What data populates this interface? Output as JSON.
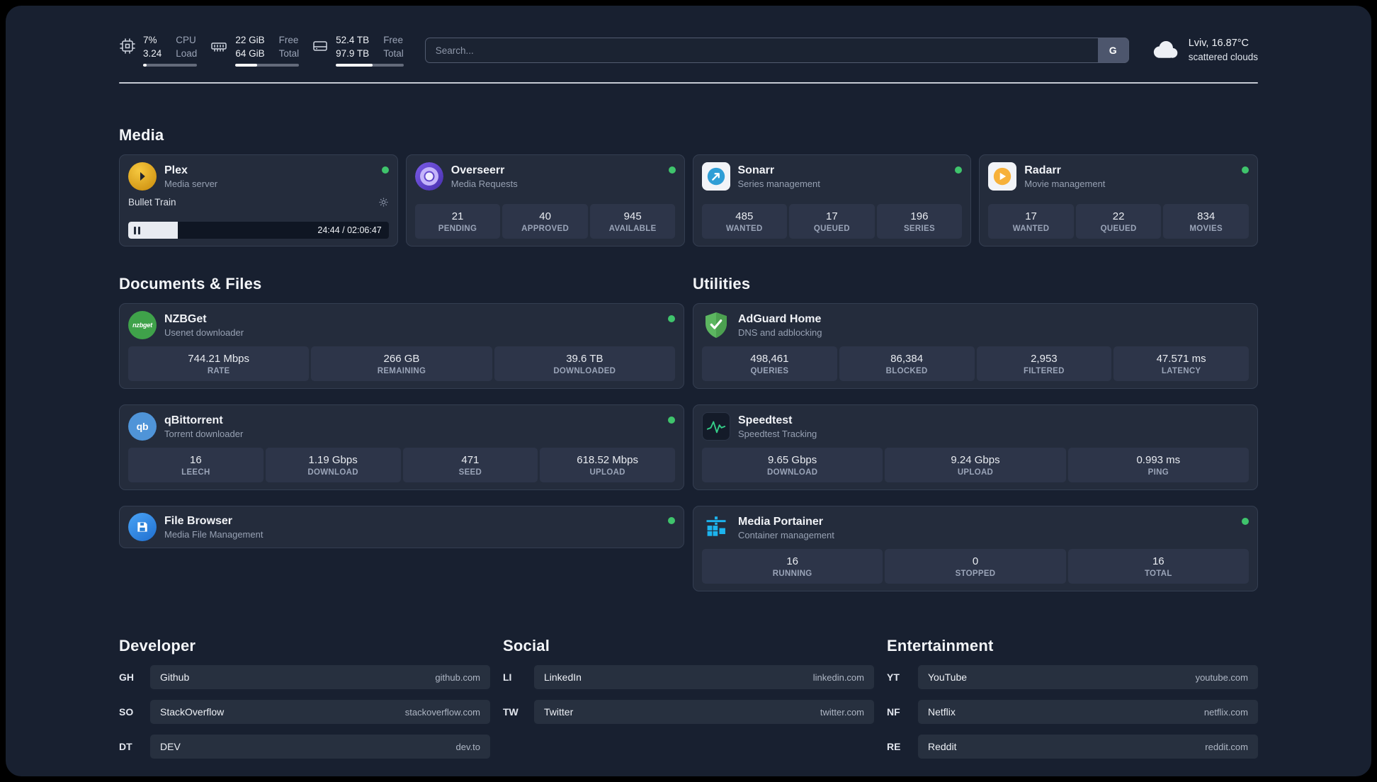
{
  "topbar": {
    "cpu": {
      "value1": "7%",
      "value2": "3.24",
      "label1": "CPU",
      "label2": "Load",
      "bar_percent": 7
    },
    "ram": {
      "value1": "22 GiB",
      "value2": "64 GiB",
      "label1": "Free",
      "label2": "Total",
      "bar_percent": 34
    },
    "disk": {
      "value1": "52.4 TB",
      "value2": "97.9 TB",
      "label1": "Free",
      "label2": "Total",
      "bar_percent": 54
    },
    "search": {
      "placeholder": "Search...",
      "button_label": "G"
    },
    "weather": {
      "location": "Lviv, 16.87°C",
      "condition": "scattered clouds"
    }
  },
  "sections": {
    "media": "Media",
    "documents": "Documents & Files",
    "utilities": "Utilities",
    "developer": "Developer",
    "social": "Social",
    "entertainment": "Entertainment"
  },
  "apps": {
    "plex": {
      "name": "Plex",
      "subtitle": "Media server",
      "now_playing": "Bullet Train",
      "time": "24:44 / 02:06:47",
      "progress_percent": 19
    },
    "overseerr": {
      "name": "Overseerr",
      "subtitle": "Media Requests",
      "stats": [
        {
          "value": "21",
          "label": "PENDING"
        },
        {
          "value": "40",
          "label": "APPROVED"
        },
        {
          "value": "945",
          "label": "AVAILABLE"
        }
      ]
    },
    "sonarr": {
      "name": "Sonarr",
      "subtitle": "Series management",
      "stats": [
        {
          "value": "485",
          "label": "WANTED"
        },
        {
          "value": "17",
          "label": "QUEUED"
        },
        {
          "value": "196",
          "label": "SERIES"
        }
      ]
    },
    "radarr": {
      "name": "Radarr",
      "subtitle": "Movie management",
      "stats": [
        {
          "value": "17",
          "label": "WANTED"
        },
        {
          "value": "22",
          "label": "QUEUED"
        },
        {
          "value": "834",
          "label": "MOVIES"
        }
      ]
    },
    "nzbget": {
      "name": "NZBGet",
      "subtitle": "Usenet downloader",
      "icon_text": "nzbget",
      "stats": [
        {
          "value": "744.21 Mbps",
          "label": "RATE"
        },
        {
          "value": "266 GB",
          "label": "REMAINING"
        },
        {
          "value": "39.6 TB",
          "label": "DOWNLOADED"
        }
      ]
    },
    "qbittorrent": {
      "name": "qBittorrent",
      "subtitle": "Torrent downloader",
      "icon_text": "qb",
      "stats": [
        {
          "value": "16",
          "label": "LEECH"
        },
        {
          "value": "1.19 Gbps",
          "label": "DOWNLOAD"
        },
        {
          "value": "471",
          "label": "SEED"
        },
        {
          "value": "618.52 Mbps",
          "label": "UPLOAD"
        }
      ]
    },
    "filebrowser": {
      "name": "File Browser",
      "subtitle": "Media File Management"
    },
    "adguard": {
      "name": "AdGuard Home",
      "subtitle": "DNS and adblocking",
      "stats": [
        {
          "value": "498,461",
          "label": "QUERIES"
        },
        {
          "value": "86,384",
          "label": "BLOCKED"
        },
        {
          "value": "2,953",
          "label": "FILTERED"
        },
        {
          "value": "47.571 ms",
          "label": "LATENCY"
        }
      ]
    },
    "speedtest": {
      "name": "Speedtest",
      "subtitle": "Speedtest Tracking",
      "stats": [
        {
          "value": "9.65 Gbps",
          "label": "DOWNLOAD"
        },
        {
          "value": "9.24 Gbps",
          "label": "UPLOAD"
        },
        {
          "value": "0.993 ms",
          "label": "PING"
        }
      ]
    },
    "portainer": {
      "name": "Media Portainer",
      "subtitle": "Container management",
      "stats": [
        {
          "value": "16",
          "label": "RUNNING"
        },
        {
          "value": "0",
          "label": "STOPPED"
        },
        {
          "value": "16",
          "label": "TOTAL"
        }
      ]
    }
  },
  "bookmarks": {
    "developer": [
      {
        "abbr": "GH",
        "name": "Github",
        "url": "github.com"
      },
      {
        "abbr": "SO",
        "name": "StackOverflow",
        "url": "stackoverflow.com"
      },
      {
        "abbr": "DT",
        "name": "DEV",
        "url": "dev.to"
      }
    ],
    "social": [
      {
        "abbr": "LI",
        "name": "LinkedIn",
        "url": "linkedin.com"
      },
      {
        "abbr": "TW",
        "name": "Twitter",
        "url": "twitter.com"
      }
    ],
    "entertainment": [
      {
        "abbr": "YT",
        "name": "YouTube",
        "url": "youtube.com"
      },
      {
        "abbr": "NF",
        "name": "Netflix",
        "url": "netflix.com"
      },
      {
        "abbr": "RE",
        "name": "Reddit",
        "url": "reddit.com"
      }
    ]
  },
  "colors": {
    "status_green": "#3fc46c",
    "plex_amber": "#e5a00d",
    "adguard_green": "#5cb660",
    "portainer_blue": "#1cb4ee",
    "speedtest_green": "#35d08a"
  }
}
